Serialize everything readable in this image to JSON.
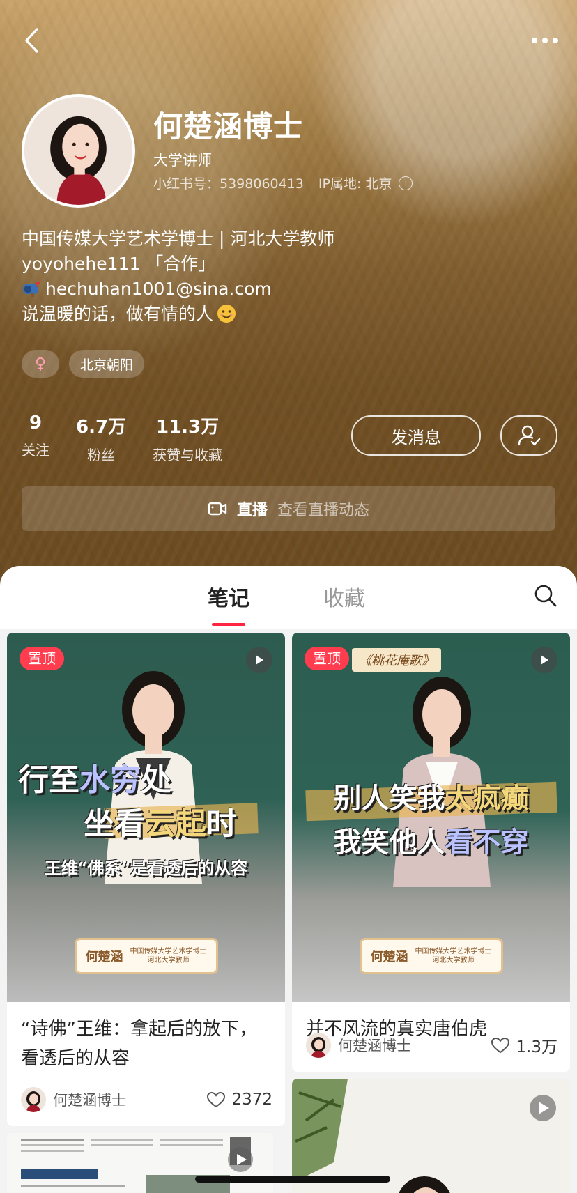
{
  "profile": {
    "name": "何楚涵博士",
    "role": "大学讲师",
    "red_id": "小红书号：5398060413",
    "ip_location": "IP属地: 北京",
    "bio_lines": [
      "中国传媒大学艺术学博士 | 河北大学教师",
      "yoyohehe111 「合作」",
      "hechuhan1001@sina.com",
      "说温暖的话，做有情的人"
    ],
    "tags": {
      "gender": "♀",
      "location": "北京朝阳"
    }
  },
  "stats": [
    {
      "num": "9",
      "label": "关注"
    },
    {
      "num": "6.7万",
      "label": "粉丝"
    },
    {
      "num": "11.3万",
      "label": "获赞与收藏"
    }
  ],
  "actions": {
    "message": "发消息"
  },
  "live": {
    "label": "直播",
    "sub": "查看直播动态"
  },
  "tabs": {
    "notes": "笔记",
    "collect": "收藏"
  },
  "cards": [
    {
      "pin": "置顶",
      "cover_lines": [
        "行至水穷处",
        "坐看云起时",
        "王维“佛系”是看透后的从容"
      ],
      "badge_name": "何楚涵",
      "badge_desc": "中国传媒大学艺术学博士 河北大学教师",
      "title": "“诗佛”王维：拿起后的放下，看透后的从容",
      "author": "何楚涵博士",
      "likes": "2372"
    },
    {
      "pin": "置顶",
      "cover_tag": "《桃花庵歌》",
      "cover_lines": [
        "别人笑我太疯癫",
        "我笑他人看不穿"
      ],
      "badge_name": "何楚涵",
      "badge_desc": "中国传媒大学艺术学博士 河北大学教师",
      "title": "并不风流的真实唐伯虎",
      "author": "何楚涵博士",
      "likes": "1.3万"
    }
  ],
  "colors": {
    "accent": "#ff2442",
    "pin": "#ff3d4f"
  }
}
